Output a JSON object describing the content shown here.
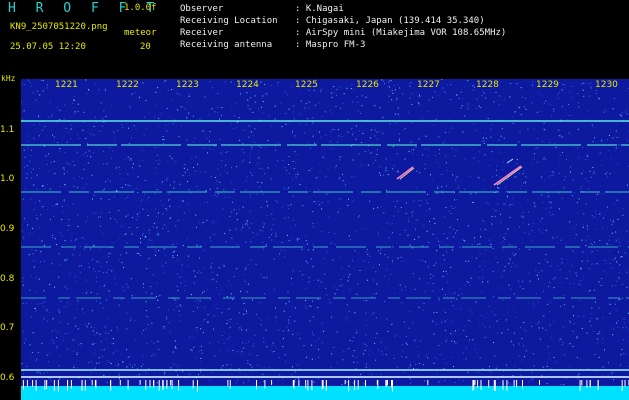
{
  "header": {
    "title": "H R O F F T",
    "version": "1.0.0f",
    "filename": "KN9_2507051220.png",
    "meteor_label": "meteor",
    "datetime": "25.07.05 12:20",
    "meteor_count": "20"
  },
  "info": [
    {
      "key": "Observer",
      "value": ": K.Nagai"
    },
    {
      "key": "Receiving Location",
      "value": ": Chigasaki, Japan (139.414 35.340)"
    },
    {
      "key": "Receiver",
      "value": ": AirSpy mini (Miakejima VOR 108.65MHz)"
    },
    {
      "key": "Receiving antenna",
      "value": ": Maspro FM-3"
    }
  ],
  "spectrogram": {
    "y_unit": "kHz",
    "y_ticks": [
      "1.1",
      "1.0",
      "0.9",
      "0.8",
      "0.7",
      "0.6"
    ],
    "x_ticks": [
      "1221",
      "1222",
      "1223",
      "1224",
      "1225",
      "1226",
      "1227",
      "1228",
      "1229",
      "1230"
    ],
    "colors": {
      "background": "#0d1aa0",
      "labels": "#e8e800",
      "title": "#22d3d0",
      "bottom_band": "#00e0ff"
    }
  }
}
